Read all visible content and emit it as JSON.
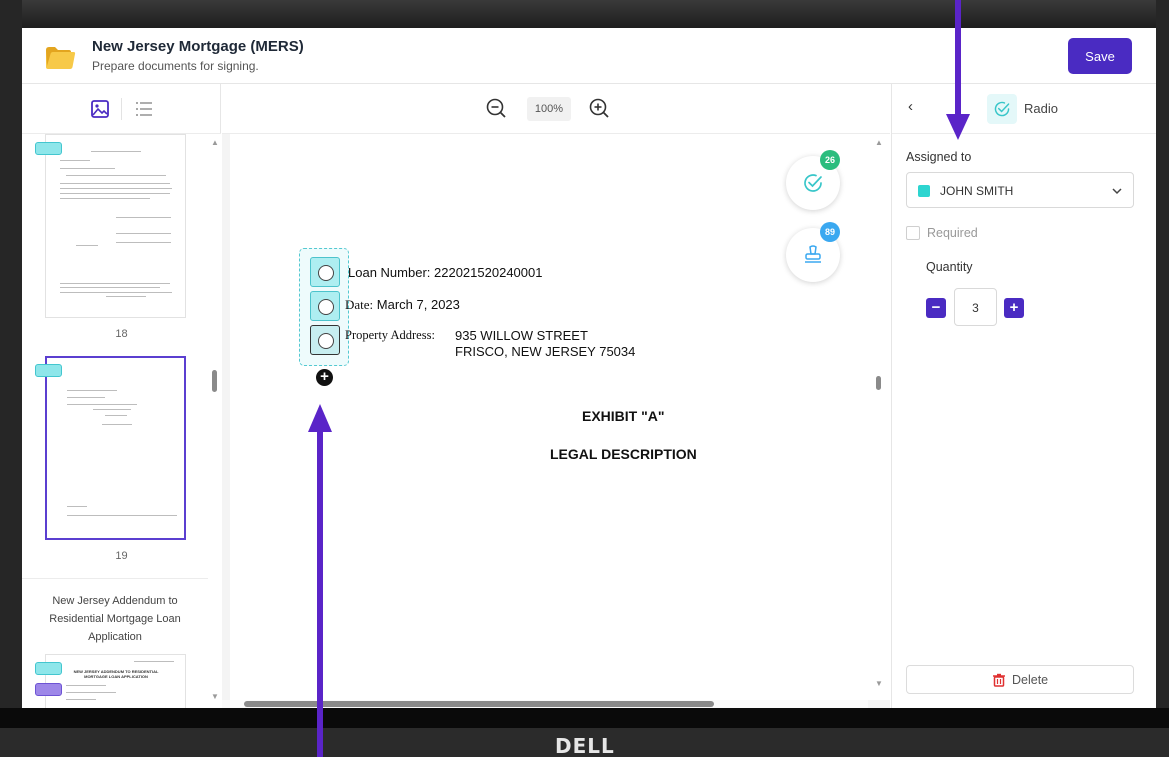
{
  "header": {
    "title": "New Jersey Mortgage (MERS)",
    "subtitle": "Prepare documents for signing.",
    "save_label": "Save"
  },
  "sidebar": {
    "thumbnails": [
      {
        "page_number": "18"
      },
      {
        "page_number": "19"
      }
    ],
    "next_document_title": "New Jersey Addendum to Residential Mortgage Loan Application",
    "next_doc_thumb_title": "NEW JERSEY ADDENDUM TO RESIDENTIAL MORTGAGE LOAN APPLICATION"
  },
  "viewer": {
    "zoom_level": "100%",
    "fab_checked_count": "26",
    "fab_stamp_count": "89",
    "document": {
      "loan_number_label": "Loan Number:",
      "loan_number_value": "222021520240001",
      "date_label": "Date:",
      "date_value": "March 7, 2023",
      "property_label": "Property Address:",
      "property_line1": "935 WILLOW STREET",
      "property_line2": "FRISCO, NEW JERSEY 75034",
      "exhibit_heading": "EXHIBIT \"A\"",
      "legal_heading": "LEGAL DESCRIPTION"
    }
  },
  "properties": {
    "field_type": "Radio",
    "assigned_label": "Assigned to",
    "assignee": "JOHN SMITH",
    "assignee_color": "#2dd5d0",
    "required_label": "Required",
    "required_checked": false,
    "quantity_label": "Quantity",
    "quantity_value": "3",
    "delete_label": "Delete"
  },
  "bezel": {
    "brand": "DELL"
  },
  "colors": {
    "accent": "#4a2bc2",
    "field_teal": "#8ee6ea",
    "badge_green": "#2bbd7e",
    "badge_blue": "#3aa8f0",
    "annotation_arrow": "#5a24c8",
    "delete_red": "#e03131"
  }
}
